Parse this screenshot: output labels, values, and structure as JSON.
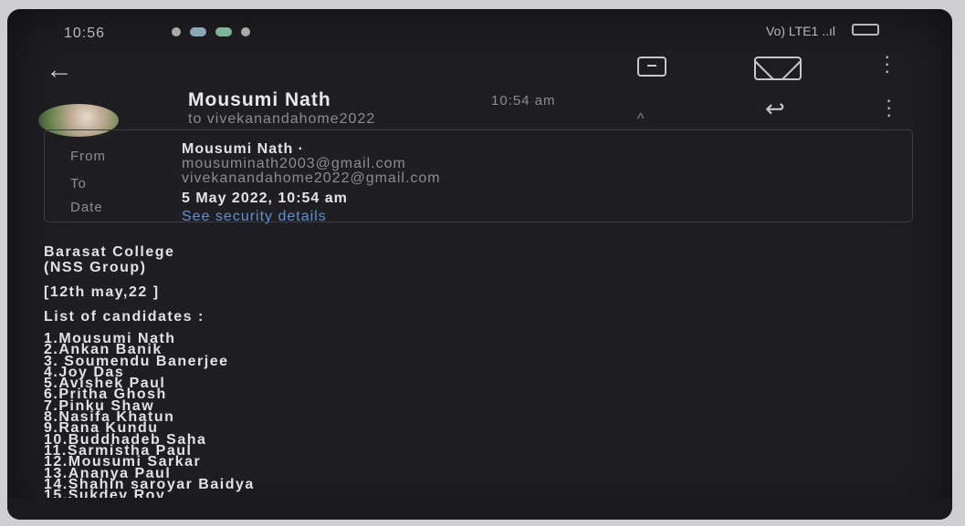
{
  "status_bar": {
    "time": "10:56",
    "signal_text": "Vo) LTE1 ..ıl"
  },
  "email": {
    "sender_name": "Mousumi Nath",
    "sent_time": "10:54 am",
    "to_summary": "to vivekanandahome2022",
    "details": {
      "from_label": "From",
      "from_name": "Mousumi Nath ·",
      "from_email": "mousuminath2003@gmail.com",
      "to_label": "To",
      "to_email": "vivekanandahome2022@gmail.com",
      "date_label": "Date",
      "date_value": "5 May 2022, 10:54 am",
      "security_link": "See security details"
    },
    "body": {
      "line1": "Barasat College",
      "line2": "(NSS Group)",
      "date_tag": "[12th may,22 ]",
      "list_heading": "List of candidates :",
      "candidates": [
        "1.Mousumi Nath",
        "2.Ankan Banik",
        "3. Soumendu Banerjee",
        "4.Joy  Das",
        "5.Avishek Paul",
        "6.Pritha Ghosh",
        "7.Pinku Shaw",
        "8.Nasifa Khatun",
        "9.Rana Kundu",
        "10.Buddhadeb Saha",
        "11.Sarmistha Paul",
        "12.Mousumi Sarkar",
        "13.Ananya Paul",
        "14.Shahin saroyar Baidya",
        "15.Sukdev Roy"
      ]
    }
  },
  "colors": {
    "background": "#1f1f22",
    "link": "#5f8fd6",
    "text": "#e2e2e6"
  }
}
